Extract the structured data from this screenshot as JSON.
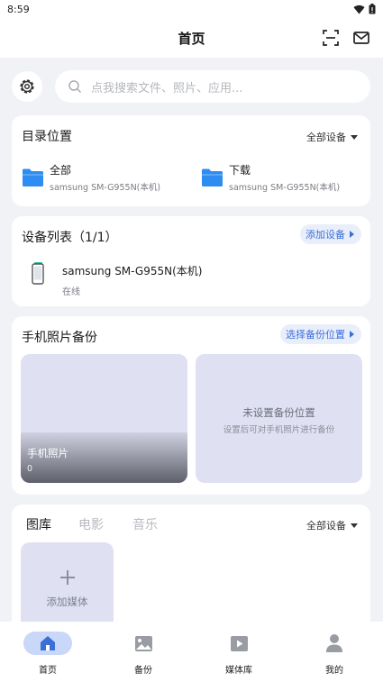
{
  "status_bar": {
    "time": "8:59"
  },
  "header": {
    "title": "首页"
  },
  "search": {
    "placeholder": "点我搜索文件、照片、应用..."
  },
  "directory": {
    "title": "目录位置",
    "filter": "全部设备",
    "items": [
      {
        "name": "全部",
        "device": "samsung SM-G955N(本机)"
      },
      {
        "name": "下载",
        "device": "samsung SM-G955N(本机)"
      }
    ]
  },
  "devices": {
    "title": "设备列表（1/1）",
    "add_label": "添加设备",
    "items": [
      {
        "name": "samsung SM-G955N(本机)",
        "status": "在线"
      }
    ]
  },
  "photo_backup": {
    "title": "手机照片备份",
    "choose_label": "选择备份位置",
    "album": {
      "name": "手机照片",
      "count": "0"
    },
    "unset": {
      "title": "未设置备份位置",
      "hint": "设置后可对手机照片进行备份"
    }
  },
  "media": {
    "tabs": [
      "图库",
      "电影",
      "音乐"
    ],
    "filter": "全部设备",
    "add_label": "添加媒体"
  },
  "bottom_nav": {
    "items": [
      {
        "label": "首页",
        "icon": "home-icon"
      },
      {
        "label": "备份",
        "icon": "backup-icon"
      },
      {
        "label": "媒体库",
        "icon": "media-library-icon"
      },
      {
        "label": "我的",
        "icon": "profile-icon"
      }
    ]
  },
  "colors": {
    "accent": "#3a6fd8",
    "nav_active_bg": "#c9d7f8",
    "folder_blue": "#2f8cf0",
    "background": "#f1f2f6"
  }
}
